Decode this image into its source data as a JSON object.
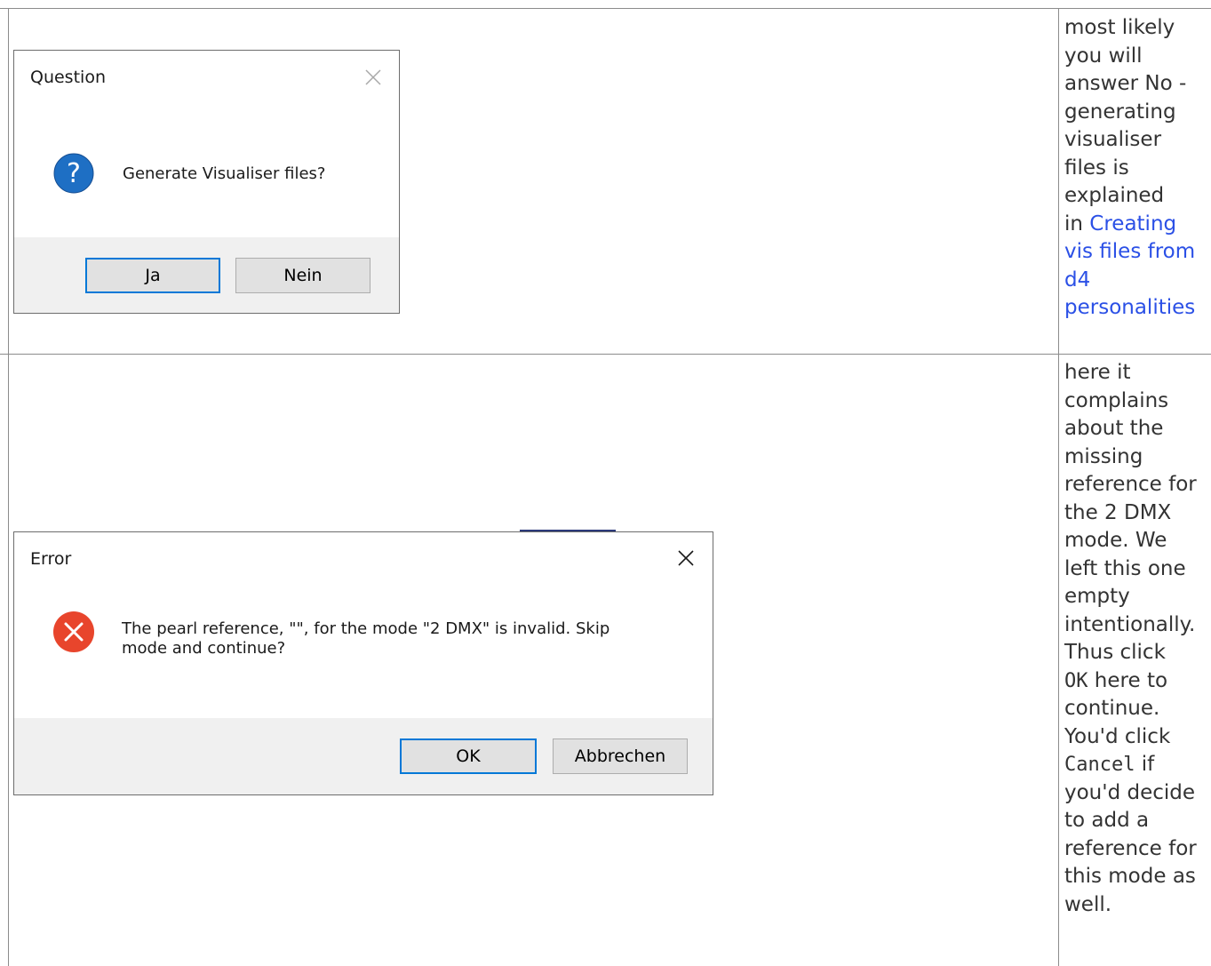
{
  "row1": {
    "dialog": {
      "title": "Question",
      "message": "Generate Visualiser files?",
      "buttons": {
        "yes": "Ja",
        "no": "Nein"
      },
      "icon": "question-icon"
    },
    "note": {
      "lines": [
        "most likely",
        "you will",
        "answer No -",
        "generating",
        "visualiser",
        "files is",
        "explained",
        "in "
      ],
      "link_lines": [
        "Creating",
        "vis files from",
        "d4",
        "personalities"
      ]
    }
  },
  "row2": {
    "dialog": {
      "title": "Error",
      "message_line1": "The pearl reference, \"\", for the mode \"2 DMX\" is invalid. Skip",
      "message_line2": "mode and continue?",
      "buttons": {
        "ok": "OK",
        "cancel": "Abbrechen"
      },
      "icon": "error-icon"
    },
    "note": {
      "lines_a": [
        "here it",
        "complains",
        "about the",
        "missing",
        "reference for",
        "the 2 DMX",
        "mode. We",
        "left this one",
        "empty",
        "intentionally.",
        "Thus click"
      ],
      "ok_code": "OK",
      "ok_suffix": " here to",
      "lines_b": [
        "continue.",
        "You'd click"
      ],
      "cancel_code": "Cancel",
      "cancel_suffix": " if",
      "lines_c": [
        "you'd decide",
        "to add a",
        "reference for",
        "this mode as",
        "well."
      ]
    }
  }
}
